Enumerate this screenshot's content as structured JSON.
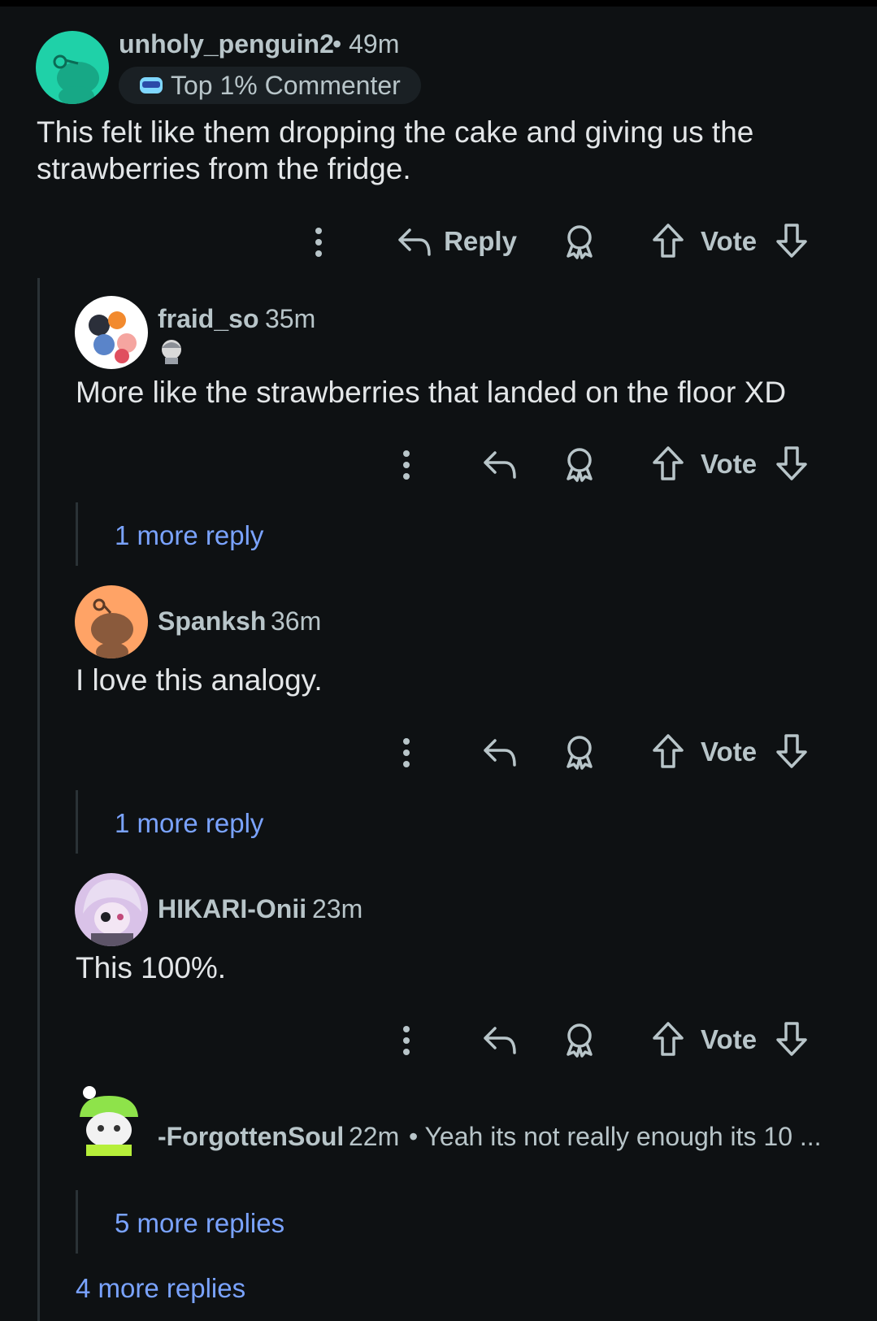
{
  "comments": [
    {
      "username": "unholy_penguin2",
      "time": "• 49m",
      "flair": "Top 1% Commenter",
      "body": "This felt like them dropping the cake and giving us the strawberries from the fridge.",
      "actions": {
        "reply": "Reply",
        "vote": "Vote"
      }
    },
    {
      "username": "fraid_so",
      "time": "35m",
      "body": "More like the strawberries that landed on the floor XD",
      "more": "1 more reply",
      "actions": {
        "vote": "Vote"
      }
    },
    {
      "username": "Spanksh",
      "time": "36m",
      "body": "I love this analogy.",
      "more": "1 more reply",
      "actions": {
        "vote": "Vote"
      }
    },
    {
      "username": "HIKARI-Onii",
      "time": "23m",
      "body": "This 100%.",
      "actions": {
        "vote": "Vote"
      }
    },
    {
      "username": "-ForgottenSoul",
      "time": "22m",
      "preview": "• Yeah its not really enough its 10 ...",
      "more": "5 more replies"
    }
  ],
  "thread_more": "4 more replies",
  "colors": {
    "background": "#0e1113",
    "link": "#7aa3ff",
    "muted": "#b8c5c9"
  }
}
